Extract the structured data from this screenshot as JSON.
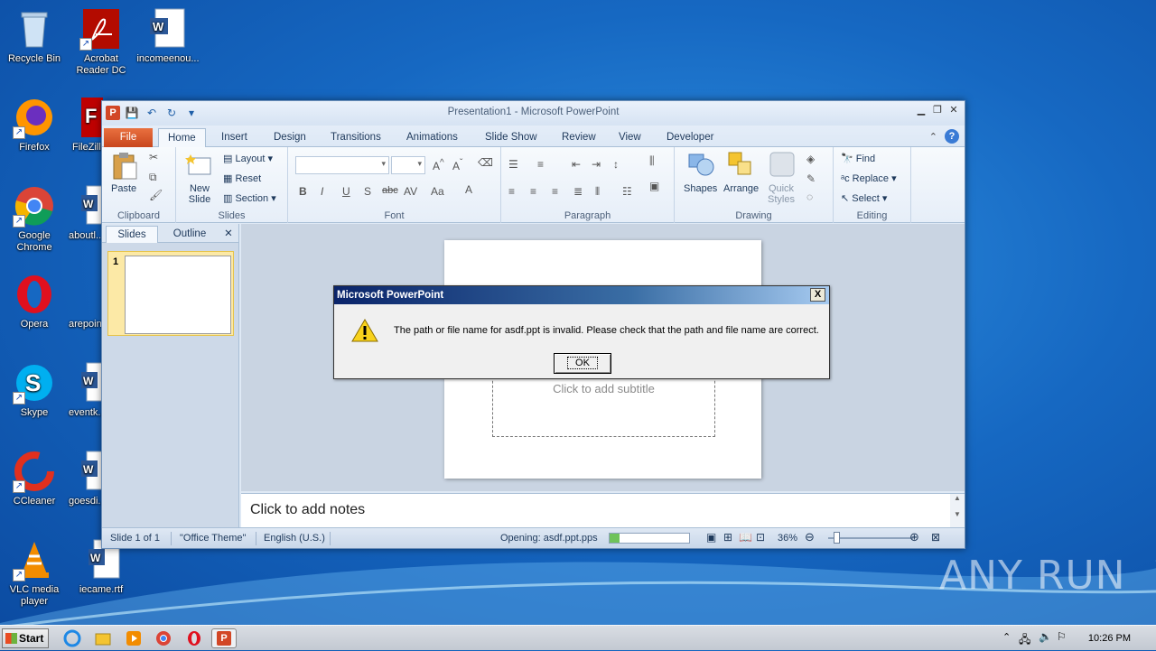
{
  "desktop": {
    "icons": [
      {
        "label": "Recycle Bin"
      },
      {
        "label": "Acrobat Reader DC"
      },
      {
        "label": "incomeenou..."
      },
      {
        "label": "Firefox"
      },
      {
        "label": "FileZilla"
      },
      {
        "label": "Google Chrome"
      },
      {
        "label": "aboutl..."
      },
      {
        "label": "Opera"
      },
      {
        "label": "arepoint"
      },
      {
        "label": "Skype"
      },
      {
        "label": "eventk..."
      },
      {
        "label": "CCleaner"
      },
      {
        "label": "goesdi..."
      },
      {
        "label": "VLC media player"
      },
      {
        "label": "iecame.rtf"
      }
    ],
    "watermark": "ANY RUN"
  },
  "window": {
    "title": "Presentation1 - Microsoft PowerPoint",
    "tabs": [
      "File",
      "Home",
      "Insert",
      "Design",
      "Transitions",
      "Animations",
      "Slide Show",
      "Review",
      "View",
      "Developer"
    ],
    "active_tab": "Home"
  },
  "ribbon": {
    "clipboard": {
      "paste": "Paste",
      "label": "Clipboard"
    },
    "slides": {
      "new_slide": "New Slide",
      "layout": "Layout",
      "reset": "Reset",
      "section": "Section",
      "label": "Slides"
    },
    "font": {
      "label": "Font"
    },
    "paragraph": {
      "label": "Paragraph"
    },
    "drawing": {
      "shapes": "Shapes",
      "arrange": "Arrange",
      "quick_styles": "Quick Styles",
      "label": "Drawing"
    },
    "editing": {
      "find": "Find",
      "replace": "Replace",
      "select": "Select",
      "label": "Editing"
    }
  },
  "panel": {
    "tab_slides": "Slides",
    "tab_outline": "Outline",
    "slide_number": "1"
  },
  "slide": {
    "subtitle_placeholder": "Click to add subtitle"
  },
  "notes": {
    "placeholder": "Click to add notes"
  },
  "status": {
    "slide_info": "Slide 1 of 1",
    "theme": "\"Office Theme\"",
    "language": "English (U.S.)",
    "opening": "Opening: asdf.ppt.pps",
    "progress": 0.12,
    "zoom": "36%"
  },
  "dialog": {
    "title": "Microsoft PowerPoint",
    "message": "The path or file name for asdf.ppt is invalid. Please check that the path and file name are correct.",
    "ok": "OK",
    "close": "X"
  },
  "taskbar": {
    "start": "Start",
    "clock": "10:26 PM"
  }
}
